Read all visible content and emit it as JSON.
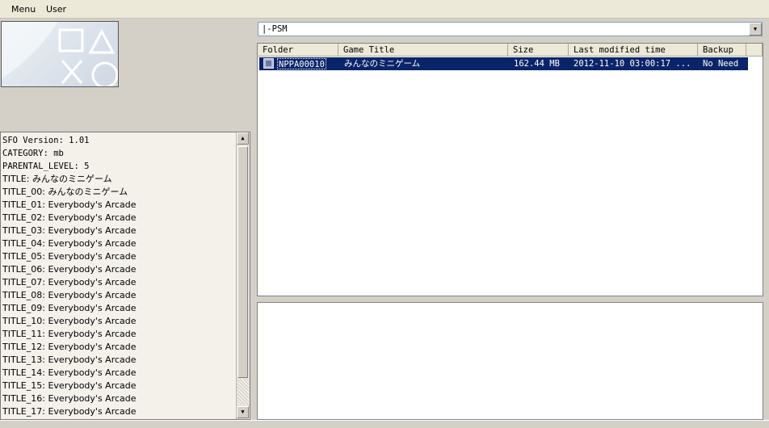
{
  "menu": {
    "items": [
      {
        "label": "Menu"
      },
      {
        "label": "User"
      }
    ]
  },
  "sfo": {
    "lines": [
      "SFO Version: 1.01",
      "CATEGORY: mb",
      "PARENTAL_LEVEL: 5",
      "TITLE: みんなのミニゲーム",
      "TITLE_00: みんなのミニゲーム",
      "TITLE_01: Everybody's Arcade",
      "TITLE_02: Everybody's Arcade",
      "TITLE_03: Everybody's Arcade",
      "TITLE_04: Everybody's Arcade",
      "TITLE_05: Everybody's Arcade",
      "TITLE_06: Everybody's Arcade",
      "TITLE_07: Everybody's Arcade",
      "TITLE_08: Everybody's Arcade",
      "TITLE_09: Everybody's Arcade",
      "TITLE_10: Everybody's Arcade",
      "TITLE_11: Everybody's Arcade",
      "TITLE_12: Everybody's Arcade",
      "TITLE_13: Everybody's Arcade",
      "TITLE_14: Everybody's Arcade",
      "TITLE_15: Everybody's Arcade",
      "TITLE_16: Everybody's Arcade",
      "TITLE_17: Everybody's Arcade"
    ]
  },
  "filter": {
    "selected": "|-PSM"
  },
  "table": {
    "columns": [
      "Folder",
      "Game Title",
      "Size",
      "Last modified time",
      "Backup"
    ],
    "rows": [
      {
        "folder": "NPPA00010",
        "title": "みんなのミニゲーム",
        "size": "162.44 MB",
        "modified": "2012-11-10 03:00:17 ...",
        "backup": "No Need"
      }
    ]
  },
  "colors": {
    "selection": "#0a246a",
    "window_bg": "#d4d0c8"
  }
}
